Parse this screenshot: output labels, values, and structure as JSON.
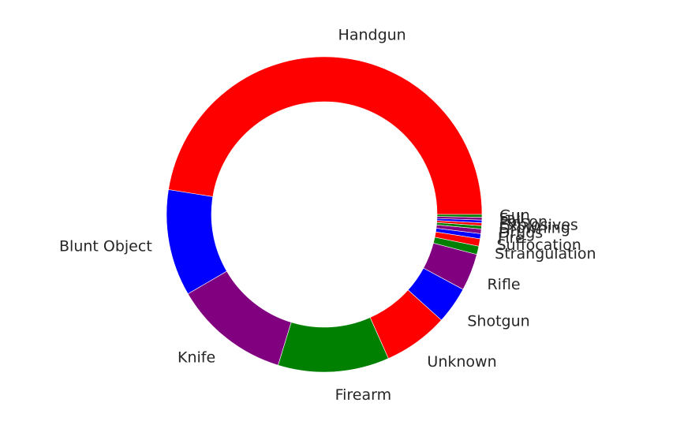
{
  "chart_data": {
    "type": "pie",
    "style": "donut",
    "start_angle_deg": 0,
    "direction": "counterclockwise",
    "categories": [
      "Handgun",
      "Blunt Object",
      "Knife",
      "Firearm",
      "Unknown",
      "Shotgun",
      "Rifle",
      "Strangulation",
      "Suffocation",
      "Fire",
      "Drugs",
      "Drowning",
      "Explosives",
      "Poison",
      "Fall",
      "Gun"
    ],
    "values": [
      50.0,
      11.5,
      12.5,
      12.0,
      7.0,
      4.0,
      4.0,
      0.9,
      0.8,
      0.55,
      0.5,
      0.35,
      0.3,
      0.3,
      0.3,
      0.3
    ],
    "colors": [
      "#ff0000",
      "#0000ff",
      "#800080",
      "#008000",
      "#ff0000",
      "#0000ff",
      "#800080",
      "#008000",
      "#ff0000",
      "#0000ff",
      "#800080",
      "#008000",
      "#ff0000",
      "#0000ff",
      "#800080",
      "#008000"
    ],
    "labels_shown": [
      "Handgun",
      "Blunt Object",
      "Knife",
      "Firearm",
      "Unknown",
      "Shotgun",
      "Rifle",
      "Strangulation",
      "Suffocation",
      "Fire",
      "Drugs",
      "Drowning",
      "Explosives",
      "Poison",
      "Fall",
      "Gun"
    ],
    "legend": "none",
    "title": ""
  }
}
